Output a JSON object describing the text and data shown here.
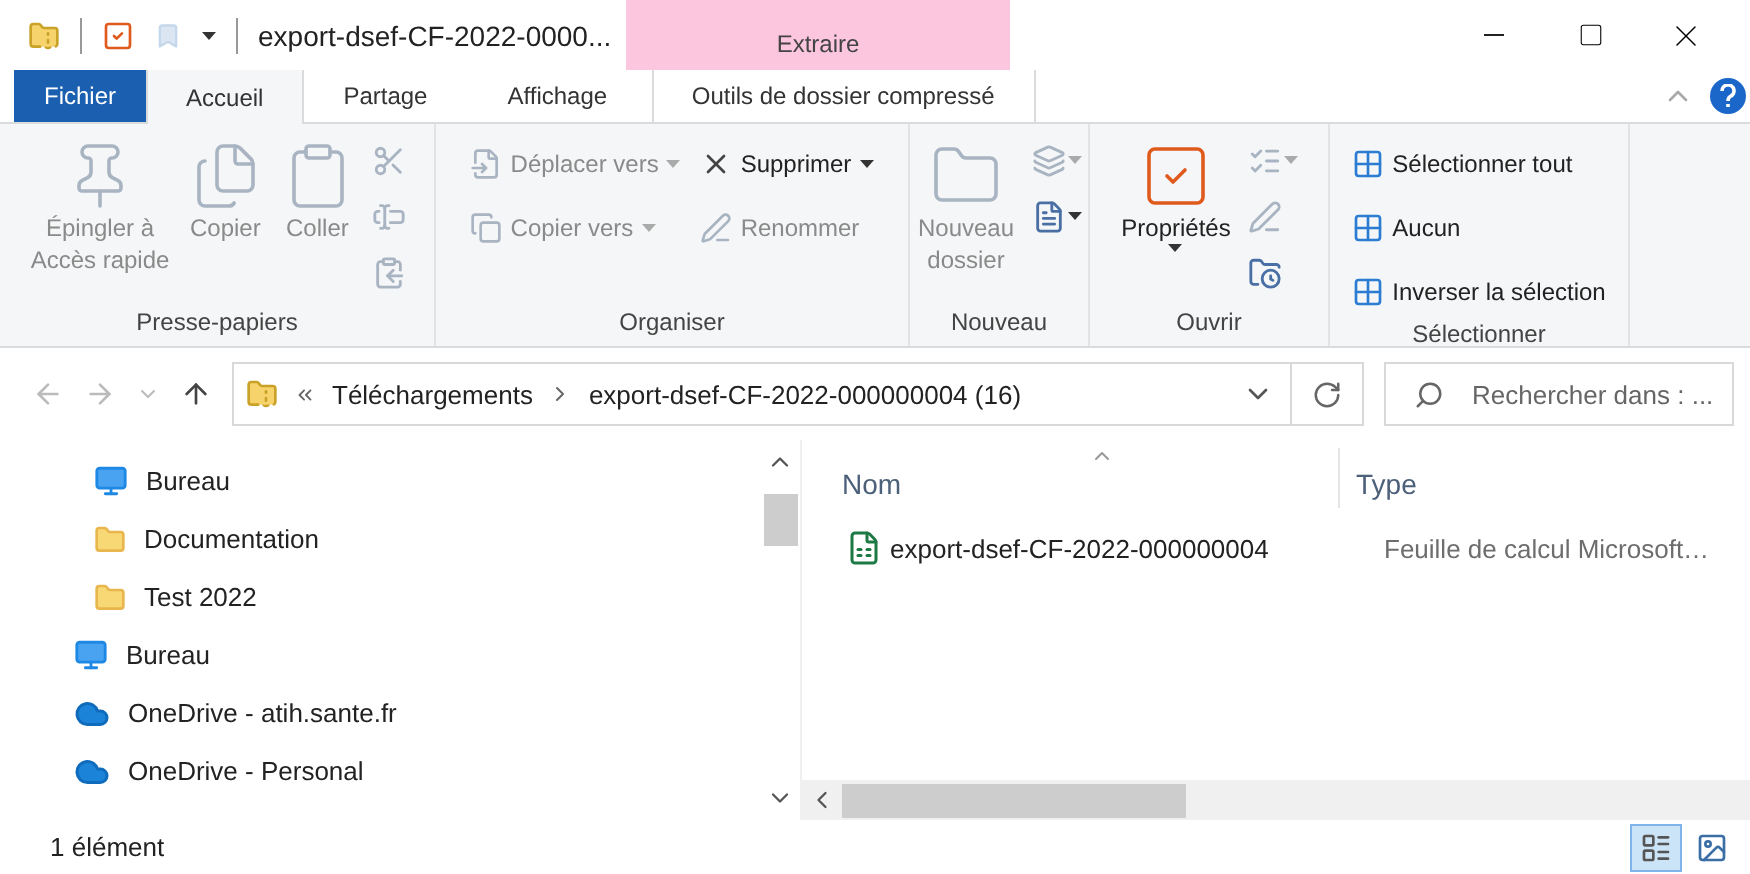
{
  "title_bar": {
    "title": "export-dsef-CF-2022-0000...",
    "context_tab": "Extraire"
  },
  "ribbon_tabs": [
    {
      "label": "Fichier",
      "kind": "file",
      "selected": false
    },
    {
      "label": "Accueil",
      "kind": "tab",
      "selected": true
    },
    {
      "label": "Partage",
      "kind": "tab",
      "selected": false
    },
    {
      "label": "Affichage",
      "kind": "tab",
      "selected": false
    },
    {
      "label": "Outils de dossier compressé",
      "kind": "context",
      "selected": false
    }
  ],
  "ribbon_groups": [
    {
      "label": "Presse-papiers",
      "columns": [
        [
          {
            "kind": "large",
            "label": "Épingler à\nAccès rapide",
            "disabled": true,
            "dropdown": false
          }
        ],
        [
          {
            "kind": "large",
            "label": "Copier",
            "disabled": true,
            "dropdown": false
          }
        ],
        [
          {
            "kind": "large",
            "label": "Coller",
            "disabled": true,
            "dropdown": false
          }
        ],
        [
          {
            "kind": "icon",
            "disabled": true,
            "dropdown": false
          },
          {
            "kind": "icon",
            "disabled": true,
            "dropdown": false
          },
          {
            "kind": "icon",
            "disabled": true,
            "dropdown": false
          }
        ]
      ]
    },
    {
      "label": "Organiser",
      "columns": [
        [
          {
            "kind": "small",
            "label": "Déplacer vers",
            "disabled": true,
            "dropdown": true
          },
          {
            "kind": "small",
            "label": "Copier vers",
            "disabled": true,
            "dropdown": true
          }
        ],
        [
          {
            "kind": "small",
            "label": "Supprimer",
            "disabled": false,
            "dropdown": true
          },
          {
            "kind": "small",
            "label": "Renommer",
            "disabled": true,
            "dropdown": false
          }
        ]
      ]
    },
    {
      "label": "Nouveau",
      "columns": [
        [
          {
            "kind": "large",
            "label": "Nouveau\ndossier",
            "disabled": true,
            "dropdown": false
          }
        ],
        [
          {
            "kind": "icon",
            "disabled": true,
            "dropdown": true
          },
          {
            "kind": "icon",
            "disabled": false,
            "dropdown": true
          }
        ]
      ]
    },
    {
      "label": "Ouvrir",
      "columns": [
        [
          {
            "kind": "large",
            "label": "Propriétés",
            "disabled": false,
            "dropdown": true
          }
        ],
        [
          {
            "kind": "icon",
            "disabled": true,
            "dropdown": true
          },
          {
            "kind": "icon",
            "disabled": true,
            "dropdown": false
          },
          {
            "kind": "icon",
            "disabled": false,
            "dropdown": false
          }
        ]
      ]
    },
    {
      "label": "Sélectionner",
      "columns": [
        [
          {
            "kind": "small",
            "label": "Sélectionner tout",
            "disabled": false,
            "dropdown": false
          },
          {
            "kind": "small",
            "label": "Aucun",
            "disabled": false,
            "dropdown": false
          },
          {
            "kind": "small",
            "label": "Inverser la sélection",
            "disabled": false,
            "dropdown": false
          }
        ]
      ]
    }
  ],
  "address_bar": {
    "path": [
      "Téléchargements",
      "export-dsef-CF-2022-000000004 (16)"
    ],
    "search_placeholder": "Rechercher dans : ..."
  },
  "nav_tree": [
    {
      "children": [
        {
          "label": "Bureau",
          "kind": "desktop"
        },
        {
          "label": "Documentation",
          "kind": "folder"
        },
        {
          "label": "Test 2022",
          "kind": "folder"
        }
      ]
    },
    {
      "label": "Bureau",
      "kind": "desktop"
    },
    {
      "label": "OneDrive - atih.sante.fr",
      "kind": "cloud"
    },
    {
      "label": "OneDrive - Personal",
      "kind": "cloud"
    }
  ],
  "file_list": {
    "columns": [
      "Nom",
      "Type"
    ],
    "rows": [
      {
        "name": "export-dsef-CF-2022-000000004",
        "type": "Feuille de calcul Microsoft…"
      }
    ]
  },
  "status_bar": {
    "text": "1 élément",
    "views": [
      {
        "kind": "details",
        "selected": true
      },
      {
        "kind": "large-icons",
        "selected": false
      }
    ]
  }
}
